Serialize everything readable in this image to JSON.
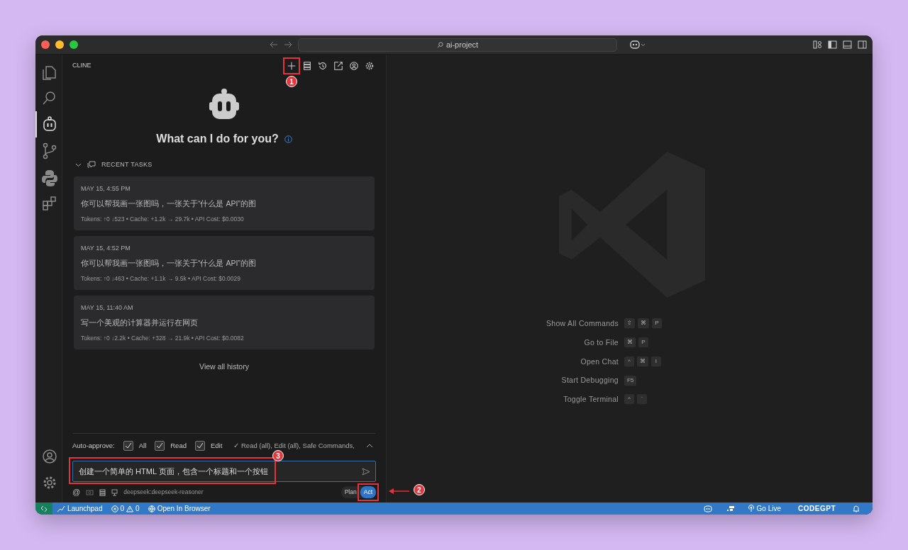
{
  "window": {
    "search": "ai-project"
  },
  "activity_bar": {
    "top": [
      {
        "kind": "files",
        "selected": false
      },
      {
        "kind": "search",
        "selected": false
      },
      {
        "kind": "cline",
        "selected": true
      },
      {
        "kind": "git",
        "selected": false
      },
      {
        "kind": "python",
        "selected": false
      },
      {
        "kind": "extensions",
        "selected": false
      }
    ],
    "bottom": [
      {
        "kind": "account",
        "selected": false
      },
      {
        "kind": "settings",
        "selected": false
      }
    ]
  },
  "panel": {
    "title": "CLINE",
    "toolbar": [
      {
        "kind": "plus",
        "callout": "1"
      },
      {
        "kind": "servers"
      },
      {
        "kind": "history"
      },
      {
        "kind": "popout"
      },
      {
        "kind": "account"
      },
      {
        "kind": "settings"
      }
    ],
    "heading": "What can I do for you?",
    "recent": {
      "title": "RECENT TASKS",
      "expanded": true,
      "tasks": [
        {
          "date": "MAY 15, 4:55 PM",
          "text": "你可以帮我画一张图吗，一张关于“什么是 API”的图",
          "meta": "Tokens: ↑0 ↓523 • Cache: +1.2k → 29.7k • API Cost: $0.0030"
        },
        {
          "date": "MAY 15, 4:52 PM",
          "text": "你可以帮我画一张图吗，一张关于“什么是 API”的图",
          "meta": "Tokens: ↑0 ↓463 • Cache: +1.1k → 9.5k • API Cost: $0.0029"
        },
        {
          "date": "MAY 15, 11:40 AM",
          "text": "写一个美观的计算器并运行在网页",
          "meta": "Tokens: ↑0 ↓2.2k • Cache: +328 → 21.9k • API Cost: $0.0082"
        }
      ],
      "link": "View all history"
    },
    "auto_approve": {
      "label": "Auto-approve:",
      "options": [
        {
          "label": "All",
          "checked": true
        },
        {
          "label": "Read",
          "checked": true
        },
        {
          "label": "Edit",
          "checked": true
        }
      ],
      "summary": "✓ Read (all), Edit (all), Safe Commands,",
      "expanded": false
    },
    "input": {
      "value": "创建一个简单的 HTML 页面，包含一个标题和一个按钮",
      "callout": "3"
    },
    "at": "@",
    "model": "deepseek:deepseek-reasoner",
    "modes": [
      {
        "label": "Plan",
        "selected": false
      },
      {
        "label": "Act",
        "selected": true,
        "callout": "2"
      }
    ]
  },
  "editor": {
    "shortcuts": [
      {
        "label": "Show All Commands",
        "keys": [
          "⇧",
          "⌘",
          "P"
        ]
      },
      {
        "label": "Go to File",
        "keys": [
          "⌘",
          "P"
        ]
      },
      {
        "label": "Open Chat",
        "keys": [
          "^",
          "⌘",
          "I"
        ]
      },
      {
        "label": "Start Debugging",
        "keys": [
          "F5"
        ]
      },
      {
        "label": "Toggle Terminal",
        "keys": [
          "^",
          "`"
        ]
      }
    ]
  },
  "status_bar": {
    "launchpad": "Launchpad",
    "errors": "0",
    "warnings": "0",
    "browser": "Open In Browser",
    "go_live": "Go Live",
    "codegpt": "CODEGPT"
  }
}
